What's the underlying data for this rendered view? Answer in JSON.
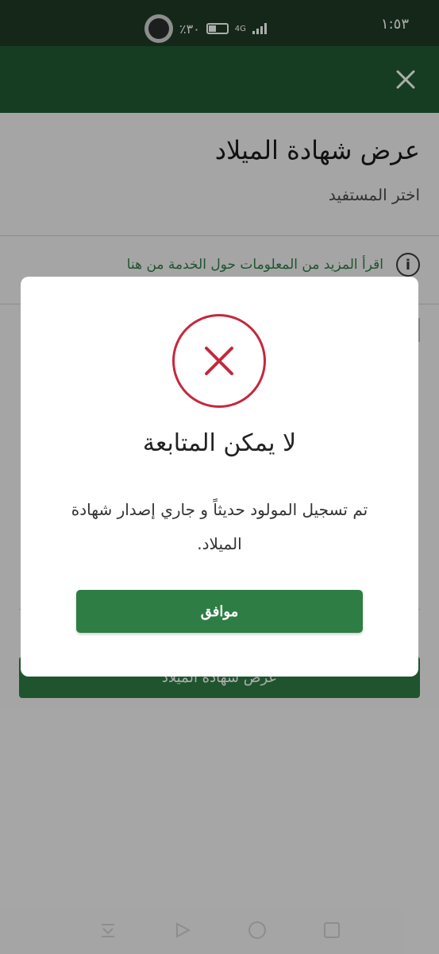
{
  "status_bar": {
    "time": "١:٥٣",
    "battery": "٪٣٠",
    "network": "4G"
  },
  "header": {
    "close_icon": "close-icon"
  },
  "page": {
    "title": "عرض شهادة الميلاد",
    "subtitle": "اختر المستفيد",
    "info_link": "اقرأ المزيد من المعلومات حول الخدمة من هنا",
    "primary_button": "عرض شهادة الميلاد"
  },
  "dialog": {
    "icon": "error-x-icon",
    "title": "لا يمكن المتابعة",
    "message": "تم تسجيل المولود حديثاً و جاري إصدار شهادة الميلاد.",
    "ok_label": "موافق"
  },
  "colors": {
    "status_bar": "#1f3a26",
    "header": "#215a33",
    "accent_green": "#2e7d45",
    "error_red": "#c5283d"
  }
}
